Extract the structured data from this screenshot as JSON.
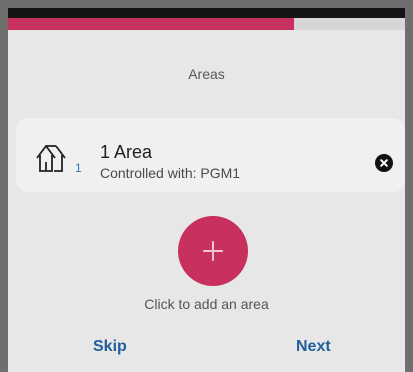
{
  "progress": {
    "fraction": 0.72
  },
  "page": {
    "title": "Areas"
  },
  "area_list": [
    {
      "name": "1 Area",
      "controlled_with": "Controlled with: PGM1",
      "count": "1",
      "icon": "house-icon"
    }
  ],
  "add_area": {
    "caption": "Click to add an area",
    "icon": "plus-icon"
  },
  "nav": {
    "skip_label": "Skip",
    "next_label": "Next"
  },
  "colors": {
    "accent": "#c8315d",
    "link": "#225f9e",
    "count": "#3a73b5"
  }
}
